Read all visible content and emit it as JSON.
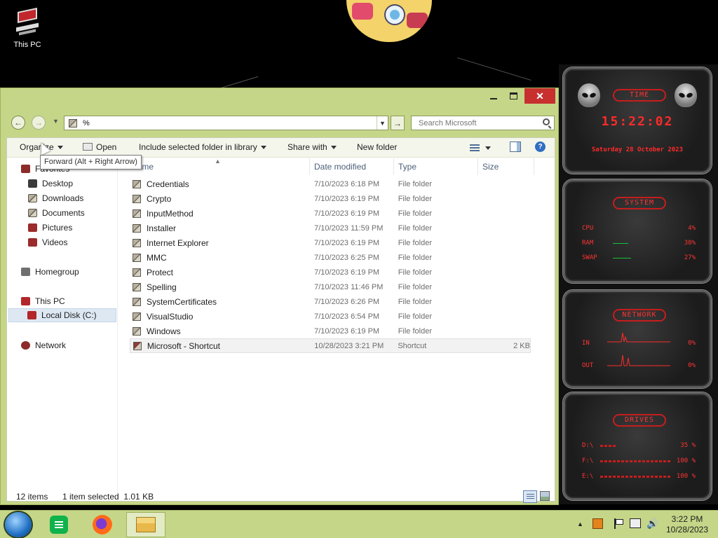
{
  "desktop": {
    "icons": [
      {
        "label": "This PC"
      }
    ]
  },
  "window": {
    "close_glyph": "✕",
    "address_value": "%",
    "search_placeholder": "Search Microsoft",
    "tooltip": "Forward (Alt + Right Arrow)"
  },
  "commandbar": {
    "organize": "Organize",
    "open": "Open",
    "include": "Include selected folder in library",
    "share": "Share with",
    "new_folder": "New folder",
    "help": "?"
  },
  "navpane": {
    "favorites": "Favorites",
    "desktop": "Desktop",
    "downloads": "Downloads",
    "documents": "Documents",
    "pictures": "Pictures",
    "videos": "Videos",
    "homegroup": "Homegroup",
    "thispc": "This PC",
    "localdisk": "Local Disk (C:)",
    "network": "Network"
  },
  "columns": {
    "name": "Name",
    "date": "Date modified",
    "type": "Type",
    "size": "Size"
  },
  "files": [
    {
      "name": "Credentials",
      "date": "7/10/2023 6:18 PM",
      "type": "File folder",
      "size": ""
    },
    {
      "name": "Crypto",
      "date": "7/10/2023 6:19 PM",
      "type": "File folder",
      "size": ""
    },
    {
      "name": "InputMethod",
      "date": "7/10/2023 6:19 PM",
      "type": "File folder",
      "size": ""
    },
    {
      "name": "Installer",
      "date": "7/10/2023 11:59 PM",
      "type": "File folder",
      "size": ""
    },
    {
      "name": "Internet Explorer",
      "date": "7/10/2023 6:19 PM",
      "type": "File folder",
      "size": ""
    },
    {
      "name": "MMC",
      "date": "7/10/2023 6:25 PM",
      "type": "File folder",
      "size": ""
    },
    {
      "name": "Protect",
      "date": "7/10/2023 6:19 PM",
      "type": "File folder",
      "size": ""
    },
    {
      "name": "Spelling",
      "date": "7/10/2023 11:46 PM",
      "type": "File folder",
      "size": ""
    },
    {
      "name": "SystemCertificates",
      "date": "7/10/2023 6:26 PM",
      "type": "File folder",
      "size": ""
    },
    {
      "name": "VisualStudio",
      "date": "7/10/2023 6:54 PM",
      "type": "File folder",
      "size": ""
    },
    {
      "name": "Windows",
      "date": "7/10/2023 6:19 PM",
      "type": "File folder",
      "size": ""
    },
    {
      "name": "Microsoft - Shortcut",
      "date": "10/28/2023 3:21 PM",
      "type": "Shortcut",
      "size": "2 KB"
    }
  ],
  "status": {
    "count": "12 items",
    "selected": "1 item selected  1.01 KB"
  },
  "widgets": {
    "time_title": "TIME",
    "time": "15:22:02",
    "date": "Saturday 28 October 2023",
    "system_title": "SYSTEM",
    "cpu_label": "CPU",
    "cpu_value": "4%",
    "ram_label": "RAM",
    "ram_value": "38%",
    "swap_label": "SWAP",
    "swap_value": "27%",
    "network_title": "NETWORK",
    "in_label": "IN",
    "in_value": "0%",
    "out_label": "OUT",
    "out_value": "0%",
    "drives_title": "DRIVES",
    "drives": [
      {
        "label": "D:\\",
        "value": "35 %"
      },
      {
        "label": "F:\\",
        "value": "100 %"
      },
      {
        "label": "E:\\",
        "value": "100 %"
      }
    ]
  },
  "taskbar": {
    "time": "3:22 PM",
    "date": "10/28/2023"
  }
}
